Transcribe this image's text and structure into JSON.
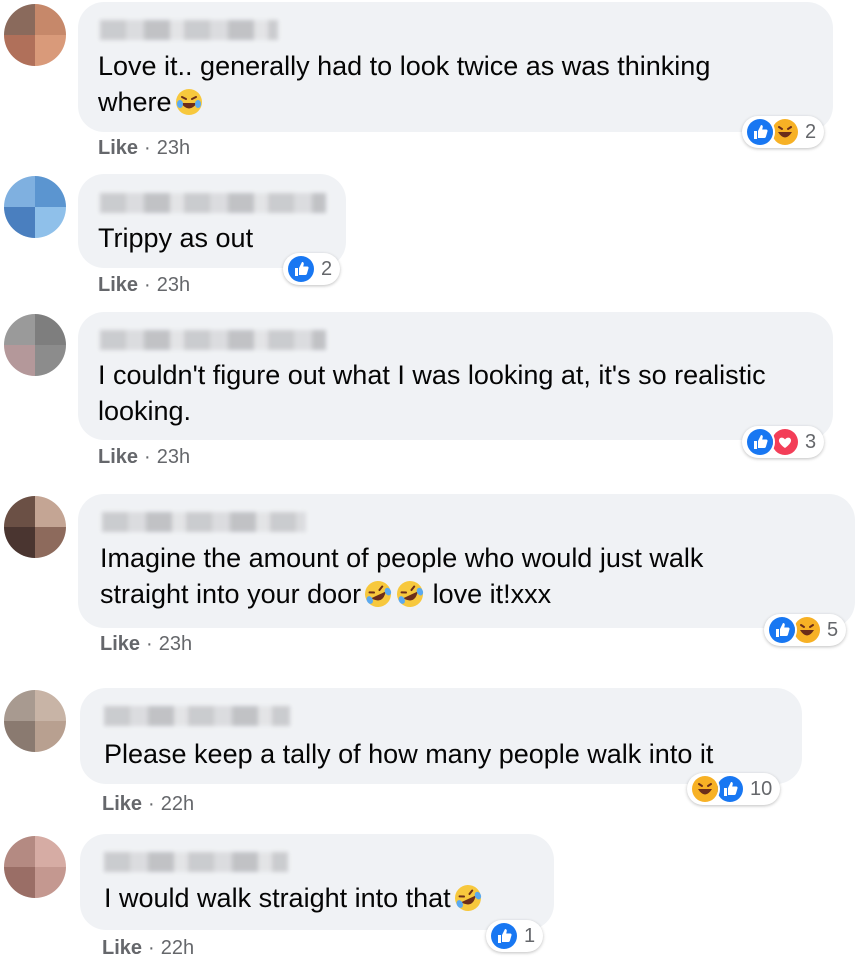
{
  "colors": {
    "bubble": "#f0f2f5",
    "like_blue": "#1877f2",
    "love_red": "#f33e58",
    "haha_yellow": "#f7b125",
    "meta_gray": "#65676b"
  },
  "comments": [
    {
      "lines": [
        "Love it.. generally had to look twice as was thinking",
        "where"
      ],
      "emoji_after": "laughing-emoji",
      "like_label": "Like",
      "time": "23h",
      "reactions": [
        "like",
        "haha"
      ],
      "reaction_count": "2"
    },
    {
      "lines": [
        "Trippy as out"
      ],
      "like_label": "Like",
      "time": "23h",
      "reactions": [
        "like"
      ],
      "reaction_count": "2"
    },
    {
      "lines": [
        "I couldn't figure out what I was looking at, it's so realistic",
        "looking."
      ],
      "like_label": "Like",
      "time": "23h",
      "reactions": [
        "like",
        "love"
      ],
      "reaction_count": "3"
    },
    {
      "lines": [
        "Imagine the amount of people who would just walk",
        "straight into your door"
      ],
      "line2_suffix": " love it!xxx",
      "like_label": "Like",
      "time": "23h",
      "reactions": [
        "like",
        "haha"
      ],
      "reaction_count": "5"
    },
    {
      "lines": [
        "Please keep a tally of how many people walk into it"
      ],
      "like_label": "Like",
      "time": "22h",
      "reactions": [
        "haha",
        "like"
      ],
      "reaction_count": "10"
    },
    {
      "lines": [
        "I would walk straight into that"
      ],
      "like_label": "Like",
      "time": "22h",
      "reactions": [
        "like"
      ],
      "reaction_count": "1"
    }
  ]
}
